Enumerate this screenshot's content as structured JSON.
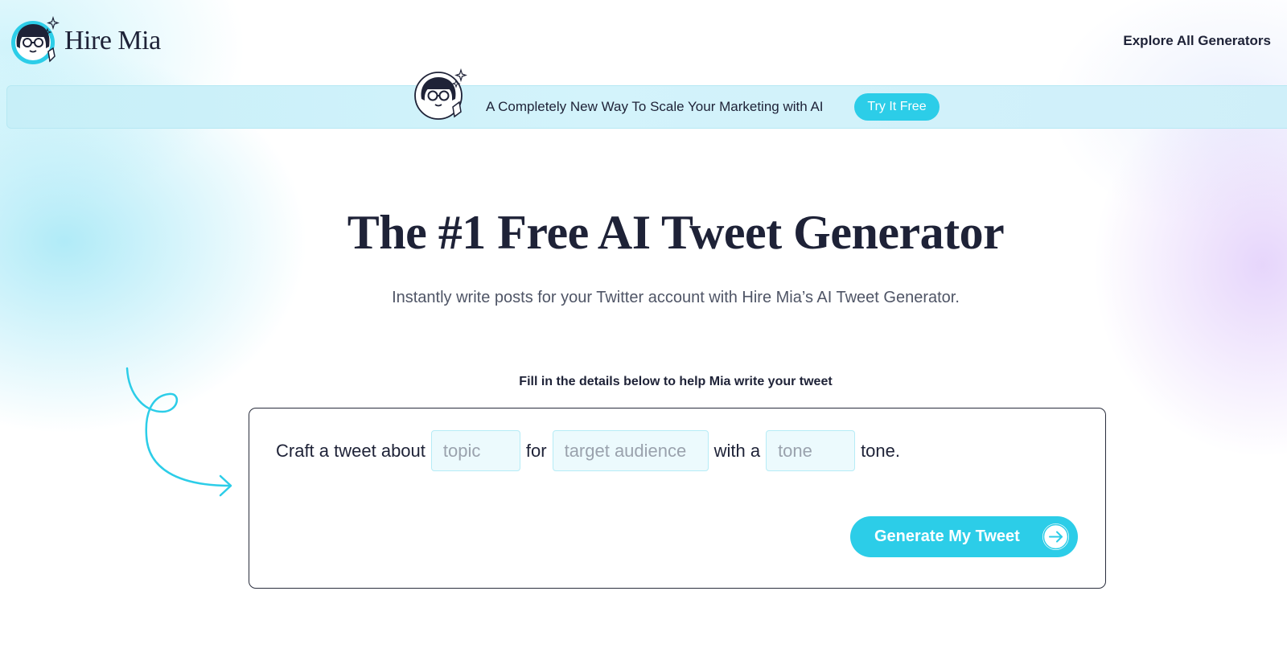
{
  "header": {
    "brand": "Hire Mia",
    "nav_link": "Explore All Generators"
  },
  "banner": {
    "text": "A Completely New Way To Scale Your Marketing with AI",
    "cta": "Try It Free"
  },
  "hero": {
    "title": "The #1 Free AI Tweet Generator",
    "subtitle": "Instantly write posts for your Twitter account with Hire Mia’s AI Tweet Generator."
  },
  "form": {
    "hint": "Fill in the details below to help Mia write your tweet",
    "prefix": "Craft a tweet about",
    "topic_placeholder": "topic",
    "connector_for": "for",
    "audience_placeholder": "target audience",
    "connector_with": "with a",
    "tone_placeholder": "tone",
    "suffix": "tone.",
    "submit": "Generate My Tweet"
  },
  "icons": {
    "avatar": "mia-avatar-icon",
    "sparkle": "sparkle-icon",
    "arrow": "arrow-right-icon",
    "doodle": "curly-arrow-doodle"
  },
  "colors": {
    "accent": "#2ccde8",
    "text": "#1e2237"
  }
}
